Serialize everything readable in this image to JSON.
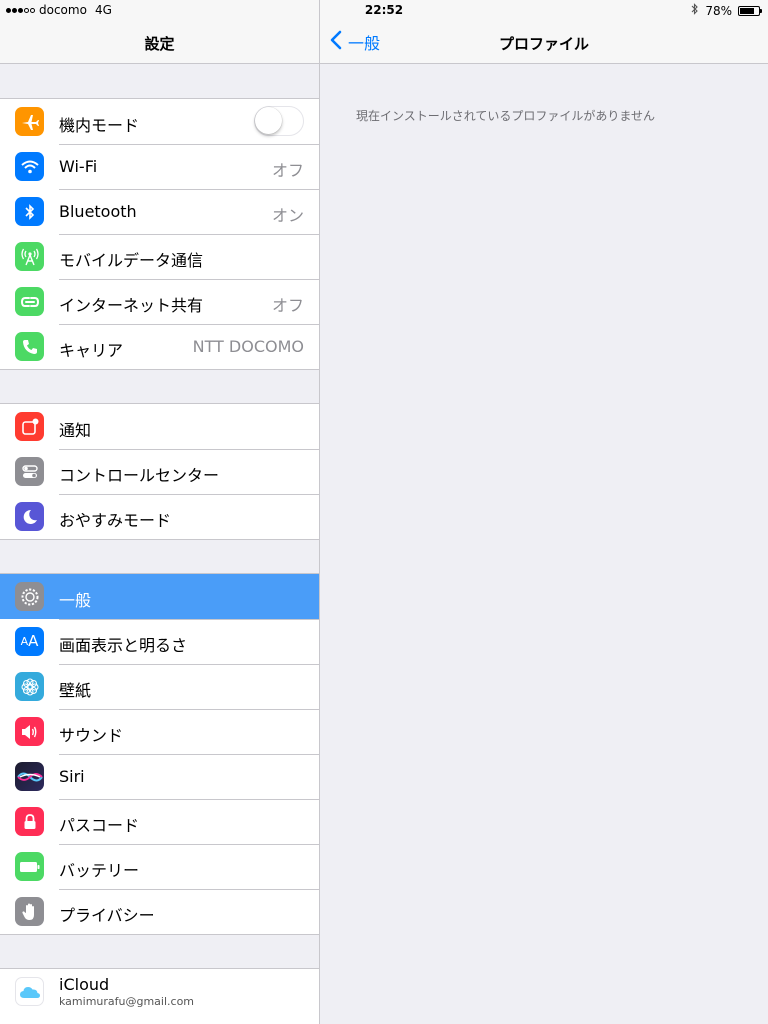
{
  "status_bar": {
    "carrier": "docomo",
    "network": "4G",
    "time": "22:52",
    "battery_percent": "78%",
    "battery_level": 0.78
  },
  "master": {
    "title": "設定",
    "groups": [
      [
        {
          "label": "機内モード",
          "icon": "airplane-icon",
          "color": "#ff9500",
          "toggle": false
        },
        {
          "label": "Wi-Fi",
          "value": "オフ",
          "icon": "wifi-icon",
          "color": "#007aff"
        },
        {
          "label": "Bluetooth",
          "value": "オン",
          "icon": "bluetooth-icon",
          "color": "#007aff"
        },
        {
          "label": "モバイルデータ通信",
          "icon": "antenna-icon",
          "color": "#4cd964"
        },
        {
          "label": "インターネット共有",
          "value": "オフ",
          "icon": "hotspot-icon",
          "color": "#4cd964"
        },
        {
          "label": "キャリア",
          "value": "NTT DOCOMO",
          "icon": "phone-icon",
          "color": "#4cd964"
        }
      ],
      [
        {
          "label": "通知",
          "icon": "notifications-icon",
          "color": "#ff3b30"
        },
        {
          "label": "コントロールセンター",
          "icon": "control-center-icon",
          "color": "#8e8e93"
        },
        {
          "label": "おやすみモード",
          "icon": "moon-icon",
          "color": "#5856d6"
        }
      ],
      [
        {
          "label": "一般",
          "icon": "gear-icon",
          "color": "#8e8e93",
          "selected": true
        },
        {
          "label": "画面表示と明るさ",
          "icon": "display-icon",
          "color": "#007aff"
        },
        {
          "label": "壁紙",
          "icon": "wallpaper-icon",
          "color": "#34aadc"
        },
        {
          "label": "サウンド",
          "icon": "speaker-icon",
          "color": "#ff2d55"
        },
        {
          "label": "Siri",
          "icon": "siri-icon",
          "color": "#1c1c2e"
        },
        {
          "label": "パスコード",
          "icon": "lock-icon",
          "color": "#ff2d55"
        },
        {
          "label": "バッテリー",
          "icon": "battery-icon",
          "color": "#4cd964"
        },
        {
          "label": "プライバシー",
          "icon": "hand-icon",
          "color": "#8e8e93"
        }
      ]
    ],
    "icloud": {
      "label": "iCloud",
      "email": "kamimurafu@gmail.com",
      "icon": "icloud-icon",
      "color": "#ffffff"
    }
  },
  "detail": {
    "back_label": "一般",
    "title": "プロファイル",
    "empty_message": "現在インストールされているプロファイルがありません"
  }
}
